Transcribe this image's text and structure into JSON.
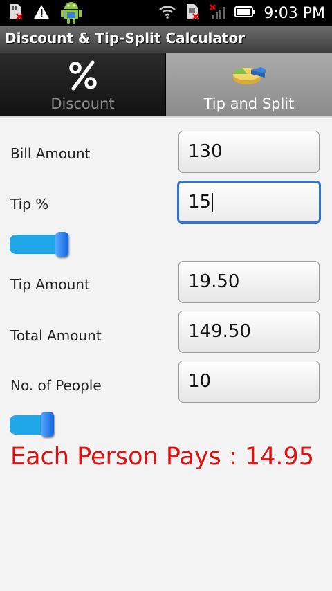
{
  "status_bar": {
    "time": "9:03 PM",
    "icons": [
      "sd-card-icon",
      "warning-icon",
      "android-icon",
      "wifi-icon",
      "sim-icon",
      "no-signal-icon",
      "signal-bars-icon",
      "battery-icon"
    ]
  },
  "app": {
    "title": "Discount & Tip-Split Calculator"
  },
  "tabs": [
    {
      "label": "Discount",
      "icon": "percent-icon",
      "selected": false
    },
    {
      "label": "Tip and Split",
      "icon": "pie-chart-icon",
      "selected": true
    }
  ],
  "form": {
    "bill_amount": {
      "label": "Bill Amount",
      "value": "130"
    },
    "tip_percent": {
      "label": "Tip %",
      "value": "15"
    },
    "tip_amount": {
      "label": "Tip Amount",
      "value": "19.50"
    },
    "total_amount": {
      "label": "Total Amount",
      "value": "149.50"
    },
    "people": {
      "label": "No. of People",
      "value": "10"
    }
  },
  "sliders": {
    "tip_slider": {
      "level": 0.15
    },
    "people_slider": {
      "level": 0.1
    }
  },
  "result": {
    "text": "Each Person Pays : 14.95"
  },
  "colors": {
    "result_text": "#e01010",
    "focus_border": "#2f73d6",
    "slider_track": "#1ea6e6",
    "slider_thumb": "#1266de"
  }
}
